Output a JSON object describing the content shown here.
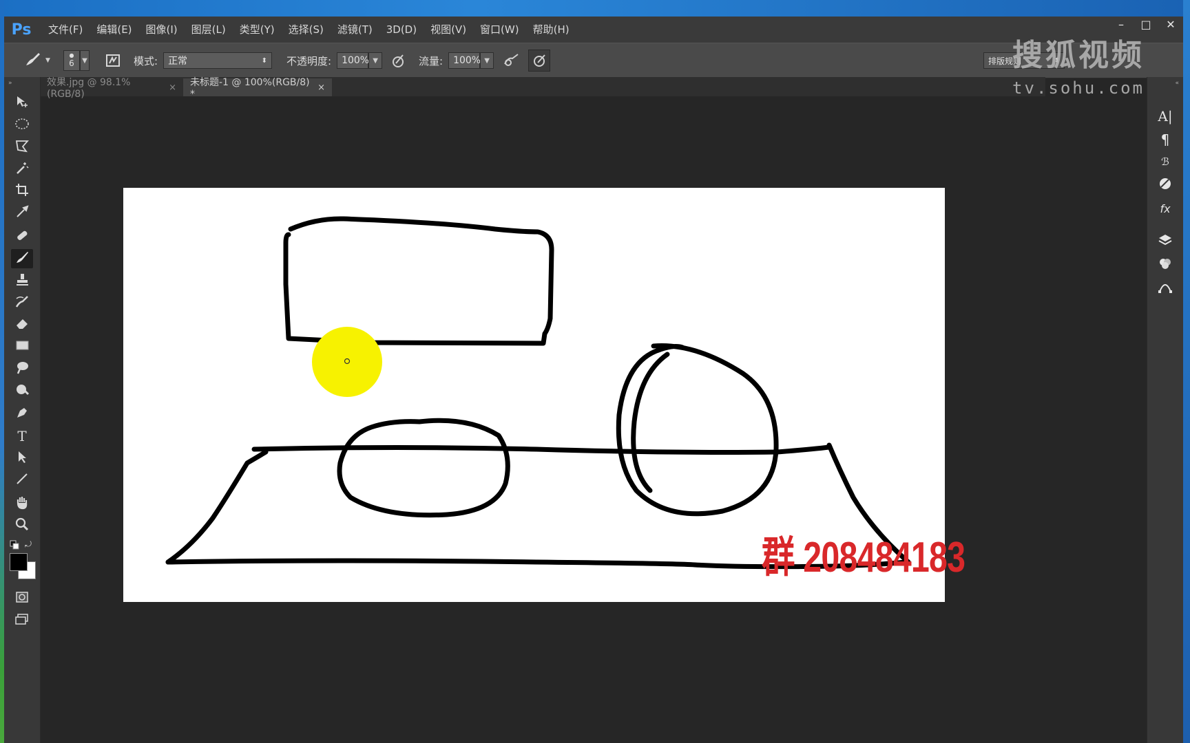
{
  "app": {
    "logo": "Ps"
  },
  "menu": [
    "文件(F)",
    "编辑(E)",
    "图像(I)",
    "图层(L)",
    "类型(Y)",
    "选择(S)",
    "滤镜(T)",
    "3D(D)",
    "视图(V)",
    "窗口(W)",
    "帮助(H)"
  ],
  "window_controls": {
    "minimize": "–",
    "maximize": "□",
    "close": "✕"
  },
  "options": {
    "brush_size": "6",
    "mode_label": "模式:",
    "mode_value": "正常",
    "opacity_label": "不透明度:",
    "opacity_value": "100%",
    "flow_label": "流量:",
    "flow_value": "100%",
    "workspace_value": "排版规则"
  },
  "tabs": [
    {
      "label": "效果.jpg @ 98.1%(RGB/8)",
      "close": "×",
      "active": false
    },
    {
      "label": "未标题-1 @ 100%(RGB/8) *",
      "close": "×",
      "active": true
    }
  ],
  "watermark": {
    "logo": "搜狐视频",
    "url": "tv.sohu.com"
  },
  "overlay": {
    "qq_group": "群 208484183"
  },
  "colors": {
    "foreground": "#000000",
    "background": "#ffffff",
    "brush_cursor": "#f7f200",
    "overlay_text": "#d9282a"
  },
  "icons": {
    "tools": [
      "move-icon",
      "ellipse-marquee-icon",
      "polygon-lasso-icon",
      "magic-wand-icon",
      "crop-icon",
      "eyedropper-icon",
      "healing-brush-icon",
      "brush-icon",
      "clone-stamp-icon",
      "history-brush-icon",
      "eraser-icon",
      "gradient-icon",
      "blur-icon",
      "dodge-icon",
      "pen-icon",
      "type-icon",
      "path-select-icon",
      "line-icon",
      "hand-icon",
      "zoom-icon"
    ],
    "panels": [
      "character-icon",
      "paragraph-icon",
      "character-styles-icon",
      "adjustments-icon",
      "styles-icon",
      "layers-icon",
      "channels-icon",
      "paths-icon"
    ]
  }
}
